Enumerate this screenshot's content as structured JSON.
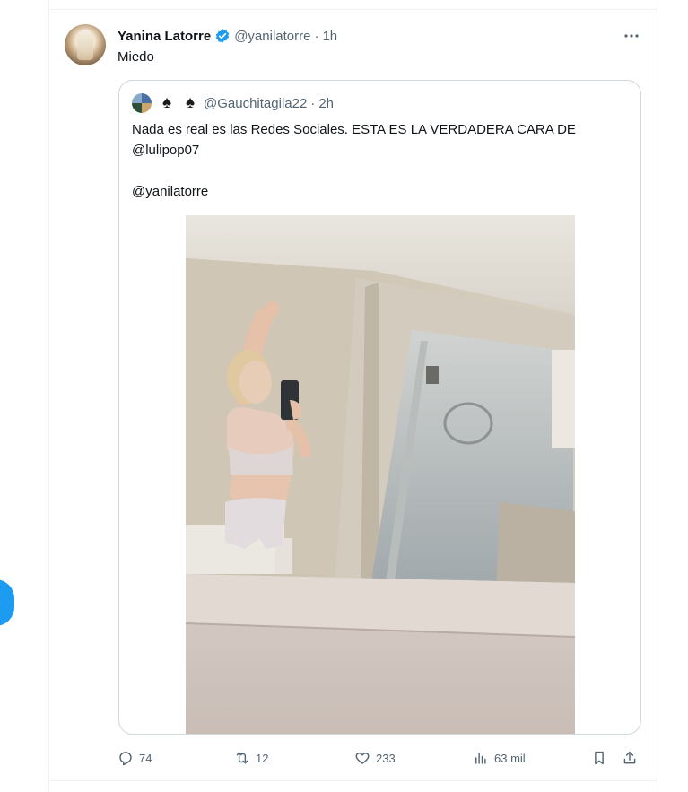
{
  "tweet": {
    "author_name": "Yanina Latorre",
    "author_handle": "@yanilatorre",
    "separator": "·",
    "time": "1h",
    "text": "Miedo",
    "more_icon": "more-dots-icon",
    "verified_color": "#1d9bf0"
  },
  "quote": {
    "handle": "@Gauchitagila22",
    "separator": "·",
    "time": "2h",
    "name_glyphs": [
      "♠",
      "♠"
    ],
    "line1": "Nada es real es las Redes Sociales. ESTA ES LA VERDADERA CARA DE",
    "line2": "@lulipop07",
    "line3": "@yanilatorre"
  },
  "actions": {
    "replies": "74",
    "reposts": "12",
    "likes": "233",
    "views": "63 mil"
  },
  "colors": {
    "accent": "#1d9bf0",
    "text_secondary": "#536471",
    "border": "#cfd9de"
  }
}
